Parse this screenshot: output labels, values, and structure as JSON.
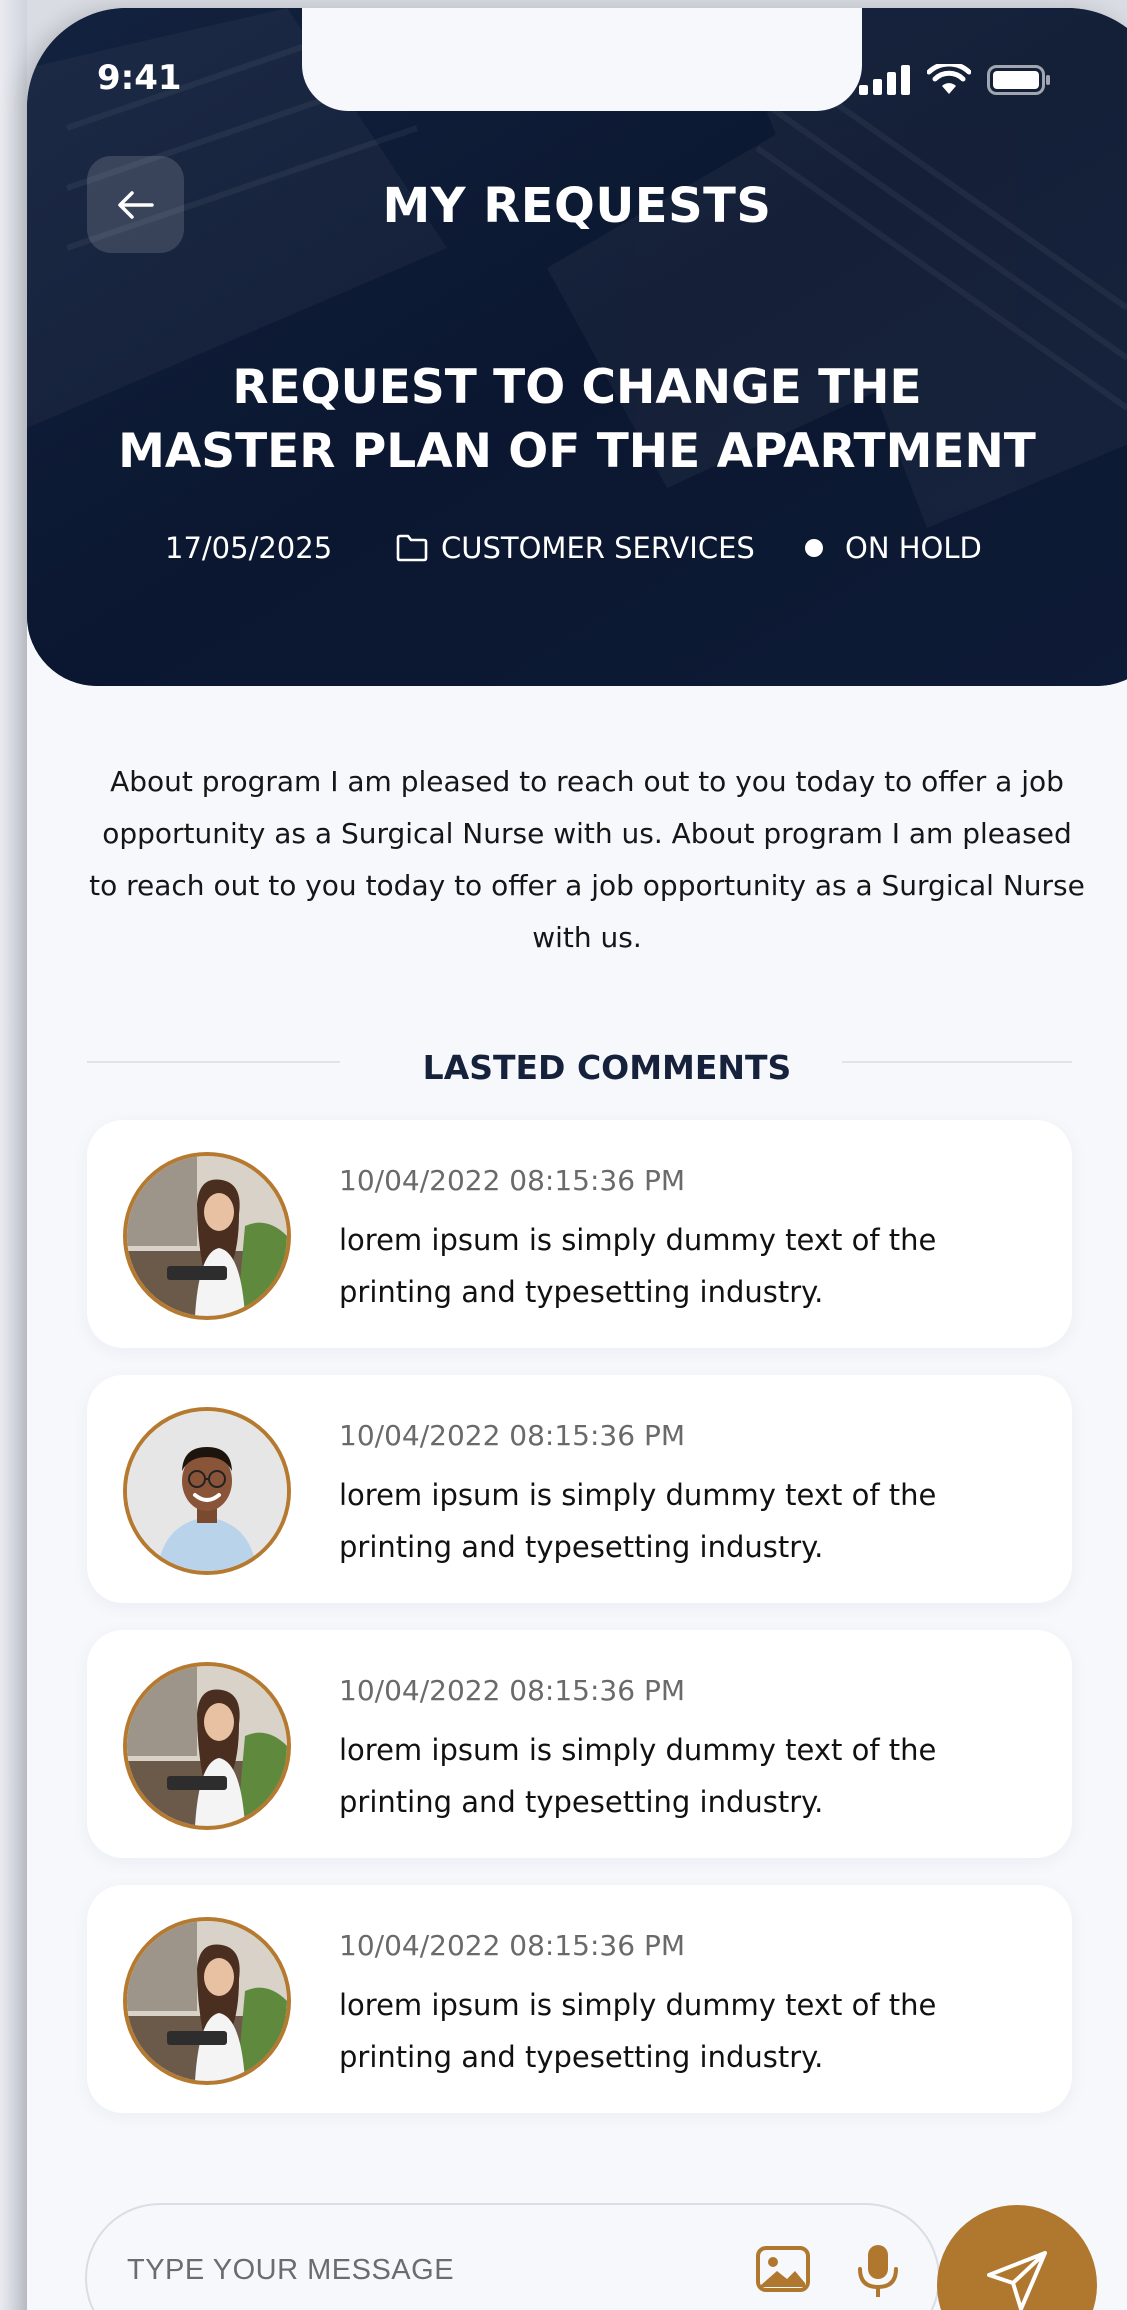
{
  "status_bar": {
    "time": "9:41"
  },
  "header": {
    "title": "MY REQUESTS"
  },
  "request": {
    "title": "REQUEST TO CHANGE THE MASTER PLAN OF THE APARTMENT",
    "date": "17/05/2025",
    "category": "CUSTOMER SERVICES",
    "status": "ON HOLD",
    "description": "About program I am pleased to reach out to you today to offer a job opportunity as a Surgical Nurse with us. About program I am pleased to reach out to you today to offer a job opportunity as a Surgical Nurse with us."
  },
  "comments_section": {
    "title": "LASTED COMMENTS"
  },
  "comments": [
    {
      "time": "10/04/2022 08:15:36 PM",
      "text": "lorem ipsum is simply dummy text of the printing and typesetting industry.",
      "avatar": "woman-headset"
    },
    {
      "time": "10/04/2022 08:15:36 PM",
      "text": "lorem ipsum is simply dummy text of the printing and typesetting industry.",
      "avatar": "man-glasses"
    },
    {
      "time": "10/04/2022 08:15:36 PM",
      "text": "lorem ipsum is simply dummy text of the printing and typesetting industry.",
      "avatar": "woman-headset"
    },
    {
      "time": "10/04/2022 08:15:36 PM",
      "text": "lorem ipsum is simply dummy text of the printing and typesetting industry.",
      "avatar": "woman-headset"
    }
  ],
  "composer": {
    "placeholder": "TYPE YOUR MESSAGE"
  },
  "colors": {
    "navy": "#0c1830",
    "accent": "#b0782f",
    "background": "#f6f8fc"
  }
}
